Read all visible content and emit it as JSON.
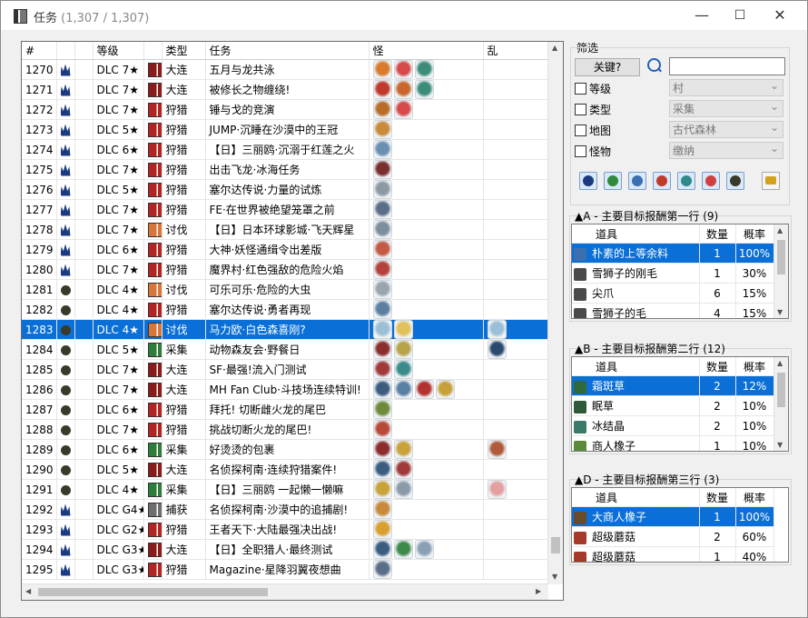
{
  "window": {
    "title": "任务",
    "count": "(1,307 / 1,307)",
    "minimize": "—",
    "maximize": "☐",
    "close": "✕"
  },
  "quest_table": {
    "headers": {
      "num": "#",
      "rank": "等级",
      "type": "类型",
      "quest": "任务",
      "monsters": "怪",
      "mixed": "乱"
    },
    "rows": [
      {
        "num": "1270",
        "icon": "flame",
        "rank": "DLC 7★",
        "type": "大连",
        "type_color": "#8b1a1a",
        "quest": "五月与龙共泳",
        "monsters": [
          "#d97b2c",
          "#d64a4a",
          "#3b8c7a"
        ]
      },
      {
        "num": "1271",
        "icon": "flame",
        "rank": "DLC 7★",
        "type": "大连",
        "type_color": "#8b1a1a",
        "quest": "被修长之物缠绕!",
        "monsters": [
          "#c0392b",
          "#c9672e",
          "#3b8c7a"
        ]
      },
      {
        "num": "1272",
        "icon": "flame",
        "rank": "DLC 7★",
        "type": "狩猎",
        "type_color": "#b52424",
        "quest": "锤与戈的竞演",
        "monsters": [
          "#b86e2a",
          "#d64a4a"
        ]
      },
      {
        "num": "1273",
        "icon": "flame",
        "rank": "DLC 5★",
        "type": "狩猎",
        "type_color": "#b52424",
        "quest": "JUMP·沉睡在沙漠中的王冠",
        "monsters": [
          "#c98a3b"
        ]
      },
      {
        "num": "1274",
        "icon": "flame",
        "rank": "DLC 6★",
        "type": "狩猎",
        "type_color": "#b52424",
        "quest": "【日】三丽鸥·沉溺于红莲之火",
        "monsters": [
          "#6b8fb0"
        ]
      },
      {
        "num": "1275",
        "icon": "flame",
        "rank": "DLC 7★",
        "type": "狩猎",
        "type_color": "#b52424",
        "quest": "出击飞龙·冰海任务",
        "monsters": [
          "#7a2f2f"
        ]
      },
      {
        "num": "1276",
        "icon": "flame",
        "rank": "DLC 5★",
        "type": "狩猎",
        "type_color": "#b52424",
        "quest": "塞尔达传说·力量的试炼",
        "monsters": [
          "#8c9aa6"
        ]
      },
      {
        "num": "1277",
        "icon": "flame",
        "rank": "DLC 7★",
        "type": "狩猎",
        "type_color": "#b52424",
        "quest": "FE·在世界被绝望笼罩之前",
        "monsters": [
          "#5a6e8a"
        ]
      },
      {
        "num": "1278",
        "icon": "flame",
        "rank": "DLC 7★",
        "type": "讨伐",
        "type_color": "#d9773a",
        "quest": "【日】日本环球影城·飞天辉星",
        "monsters": [
          "#7d8e9c"
        ]
      },
      {
        "num": "1279",
        "icon": "flame",
        "rank": "DLC 6★",
        "type": "狩猎",
        "type_color": "#b52424",
        "quest": "大神·妖怪通缉令出差版",
        "monsters": [
          "#c25a44"
        ]
      },
      {
        "num": "1280",
        "icon": "flame",
        "rank": "DLC 7★",
        "type": "狩猎",
        "type_color": "#b52424",
        "quest": "魔界村·红色强敌的危险火焰",
        "monsters": [
          "#b4423a"
        ]
      },
      {
        "num": "1281",
        "icon": "paw",
        "rank": "DLC 4★",
        "type": "讨伐",
        "type_color": "#d9773a",
        "quest": "可乐可乐·危险的大虫",
        "monsters": [
          "#9aa4ad"
        ]
      },
      {
        "num": "1282",
        "icon": "paw",
        "rank": "DLC 4★",
        "type": "狩猎",
        "type_color": "#b52424",
        "quest": "塞尔达传说·勇者再现",
        "monsters": [
          "#5d7fa0"
        ]
      },
      {
        "num": "1283",
        "icon": "paw",
        "rank": "DLC 4★",
        "type": "讨伐",
        "type_color": "#d9773a",
        "quest": "马力欧·白色森喜刚?",
        "monsters": [
          "#9bbfd6",
          "#e0c15a"
        ],
        "mixed": "#9bbfd6",
        "selected": true
      },
      {
        "num": "1284",
        "icon": "paw",
        "rank": "DLC 5★",
        "type": "采集",
        "type_color": "#2f7d3a",
        "quest": "动物森友会·野餐日",
        "monsters": [
          "#8b2d2d",
          "#b8a24a"
        ],
        "mixed": "#2a4b6e"
      },
      {
        "num": "1285",
        "icon": "paw",
        "rank": "DLC 7★",
        "type": "大连",
        "type_color": "#8b1a1a",
        "quest": "SF·最强!流入门测试",
        "monsters": [
          "#a33a3a",
          "#3a8c8c"
        ]
      },
      {
        "num": "1286",
        "icon": "paw",
        "rank": "DLC 7★",
        "type": "大连",
        "type_color": "#8b1a1a",
        "quest": "MH Fan Club·斗技场连续特训!",
        "monsters": [
          "#3c5d80",
          "#5a7fa4",
          "#b2322f",
          "#c7a03a"
        ]
      },
      {
        "num": "1287",
        "icon": "paw",
        "rank": "DLC 6★",
        "type": "狩猎",
        "type_color": "#b52424",
        "quest": "拜托! 切断雌火龙的尾巴",
        "monsters": [
          "#6f8b3a"
        ]
      },
      {
        "num": "1288",
        "icon": "paw",
        "rank": "DLC 7★",
        "type": "狩猎",
        "type_color": "#b52424",
        "quest": "挑战切断火龙的尾巴!",
        "monsters": [
          "#b84a3a"
        ]
      },
      {
        "num": "1289",
        "icon": "paw",
        "rank": "DLC 6★",
        "type": "采集",
        "type_color": "#2f7d3a",
        "quest": "好烫烫的包裹",
        "monsters": [
          "#8b2d2d",
          "#c9a23a"
        ],
        "mixed": "#b05a3a"
      },
      {
        "num": "1290",
        "icon": "paw",
        "rank": "DLC 5★",
        "type": "大连",
        "type_color": "#8b1a1a",
        "quest": "名侦探柯南·连续狩猎案件!",
        "monsters": [
          "#3a5d80",
          "#a33a3a"
        ]
      },
      {
        "num": "1291",
        "icon": "paw",
        "rank": "DLC 4★",
        "type": "采集",
        "type_color": "#2f7d3a",
        "quest": "【日】三丽鸥 一起懒一懒嘛",
        "monsters": [
          "#c9a23a",
          "#8b9aa8"
        ],
        "mixed": "#e4a0a0"
      },
      {
        "num": "1292",
        "icon": "flame",
        "rank": "DLC G4★",
        "type": "捕获",
        "type_color": "#6e6e6e",
        "quest": "名侦探柯南·沙漠中的追捕剧!",
        "monsters": [
          "#c98a3b"
        ]
      },
      {
        "num": "1293",
        "icon": "flame",
        "rank": "DLC G2★",
        "type": "狩猎",
        "type_color": "#b52424",
        "quest": "王者天下·大陆最强决出战!",
        "monsters": [
          "#d9a030"
        ]
      },
      {
        "num": "1294",
        "icon": "flame",
        "rank": "DLC G3★",
        "type": "大连",
        "type_color": "#8b1a1a",
        "quest": "【日】全职猎人·最终测试",
        "monsters": [
          "#3a5d80",
          "#3e8a4a",
          "#8aa0b4"
        ]
      },
      {
        "num": "1295",
        "icon": "flame",
        "rank": "DLC G3★",
        "type": "狩猎",
        "type_color": "#b52424",
        "quest": "Magazine·星降羽翼夜想曲",
        "monsters": [
          "#5a6e8a"
        ]
      }
    ]
  },
  "filter": {
    "title": "筛选",
    "keyword_button": "关键?",
    "keyword_value": "",
    "rows": [
      {
        "label": "等级",
        "value": "村"
      },
      {
        "label": "类型",
        "value": "采集"
      },
      {
        "label": "地图",
        "value": "古代森林"
      },
      {
        "label": "怪物",
        "value": "缴纳"
      }
    ],
    "icon_buttons": [
      {
        "name": "flame",
        "color": "#1c3a80"
      },
      {
        "name": "sword",
        "color": "#2f8a3a"
      },
      {
        "name": "gear",
        "color": "#3a6fb0"
      },
      {
        "name": "dragon",
        "color": "#c0392b"
      },
      {
        "name": "crest",
        "color": "#2f8a8a"
      },
      {
        "name": "target",
        "color": "#d04040"
      },
      {
        "name": "paw",
        "color": "#3a3a2a"
      }
    ]
  },
  "rewards": [
    {
      "title": "▲A - 主要目标报酬第一行",
      "count": "(9)",
      "headers": {
        "item": "道具",
        "qty": "数量",
        "rate": "概率"
      },
      "items": [
        {
          "icon_color": "#3a6fb0",
          "name": "朴素的上等余料",
          "qty": "1",
          "rate": "100%",
          "selected": true
        },
        {
          "icon_color": "#4a4a4a",
          "name": "雪狮子的刚毛",
          "qty": "1",
          "rate": "30%"
        },
        {
          "icon_color": "#4a4a4a",
          "name": "尖爪",
          "qty": "6",
          "rate": "15%"
        },
        {
          "icon_color": "#4a4a4a",
          "name": "雪狮子的毛",
          "qty": "4",
          "rate": "15%"
        },
        {
          "icon_color": "#6a6a6a",
          "name": "冰结晶",
          "qty": "1",
          "rate": "10%"
        }
      ]
    },
    {
      "title": "▲B - 主要目标报酬第二行",
      "count": "(12)",
      "headers": {
        "item": "道具",
        "qty": "数量",
        "rate": "概率"
      },
      "items": [
        {
          "icon_color": "#2f6a3a",
          "name": "霜斑草",
          "qty": "2",
          "rate": "12%",
          "selected": true
        },
        {
          "icon_color": "#2f5a3a",
          "name": "眠草",
          "qty": "2",
          "rate": "10%"
        },
        {
          "icon_color": "#3a7a6a",
          "name": "冰结晶",
          "qty": "2",
          "rate": "10%"
        },
        {
          "icon_color": "#5a8a3a",
          "name": "商人橡子",
          "qty": "1",
          "rate": "10%"
        },
        {
          "icon_color": "#5a8a3a",
          "name": "大商人橡子",
          "qty": "1",
          "rate": "10%"
        }
      ]
    },
    {
      "title": "▲D - 主要目标报酬第三行",
      "count": "(3)",
      "headers": {
        "item": "道具",
        "qty": "数量",
        "rate": "概率"
      },
      "items": [
        {
          "icon_color": "#6a4a2a",
          "name": "大商人橡子",
          "qty": "1",
          "rate": "100%",
          "selected": true
        },
        {
          "icon_color": "#a33a2a",
          "name": "超级蘑菇",
          "qty": "2",
          "rate": "60%"
        },
        {
          "icon_color": "#a33a2a",
          "name": "超级蘑菇",
          "qty": "1",
          "rate": "40%"
        }
      ]
    }
  ]
}
